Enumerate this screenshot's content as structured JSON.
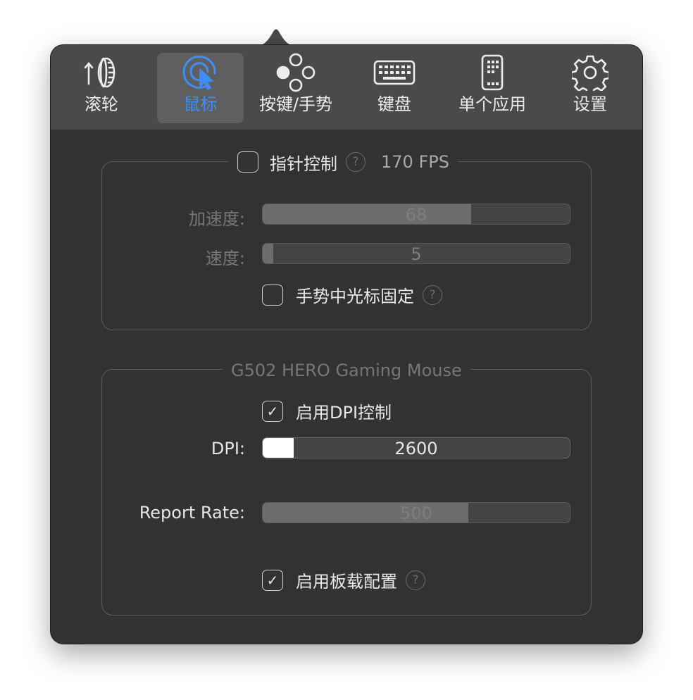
{
  "tabs": [
    {
      "label": "滚轮",
      "icon": "scroll-wheel-icon",
      "active": false
    },
    {
      "label": "鼠标",
      "icon": "cursor-click-icon",
      "active": true
    },
    {
      "label": "按键/手势",
      "icon": "buttons-dots-icon",
      "active": false
    },
    {
      "label": "键盘",
      "icon": "keyboard-icon",
      "active": false
    },
    {
      "label": "单个应用",
      "icon": "phone-app-icon",
      "active": false
    },
    {
      "label": "设置",
      "icon": "gear-icon",
      "active": false
    }
  ],
  "pointer_group": {
    "checkbox_label": "指针控制",
    "checked": false,
    "fps": "170 FPS",
    "acceleration": {
      "label": "加速度:",
      "value": "68",
      "fraction": 0.68
    },
    "speed": {
      "label": "速度:",
      "value": "5",
      "fraction": 0.035
    },
    "gesture_lock": {
      "label": "手势中光标固定",
      "checked": false
    }
  },
  "device_group": {
    "title": "G502 HERO Gaming Mouse",
    "dpi_enable": {
      "label": "启用DPI控制",
      "checked": true
    },
    "dpi": {
      "label": "DPI:",
      "value": "2600",
      "fraction": 0.1
    },
    "report_rate": {
      "label": "Report Rate:",
      "value": "500",
      "fraction": 0.67
    },
    "onboard": {
      "label": "启用板载配置",
      "checked": true
    }
  },
  "help_glyph": "?",
  "check_glyph": "✓",
  "colors": {
    "accent": "#3f8ef5",
    "panel": "#323232",
    "toolbar": "#4a4a4a"
  }
}
